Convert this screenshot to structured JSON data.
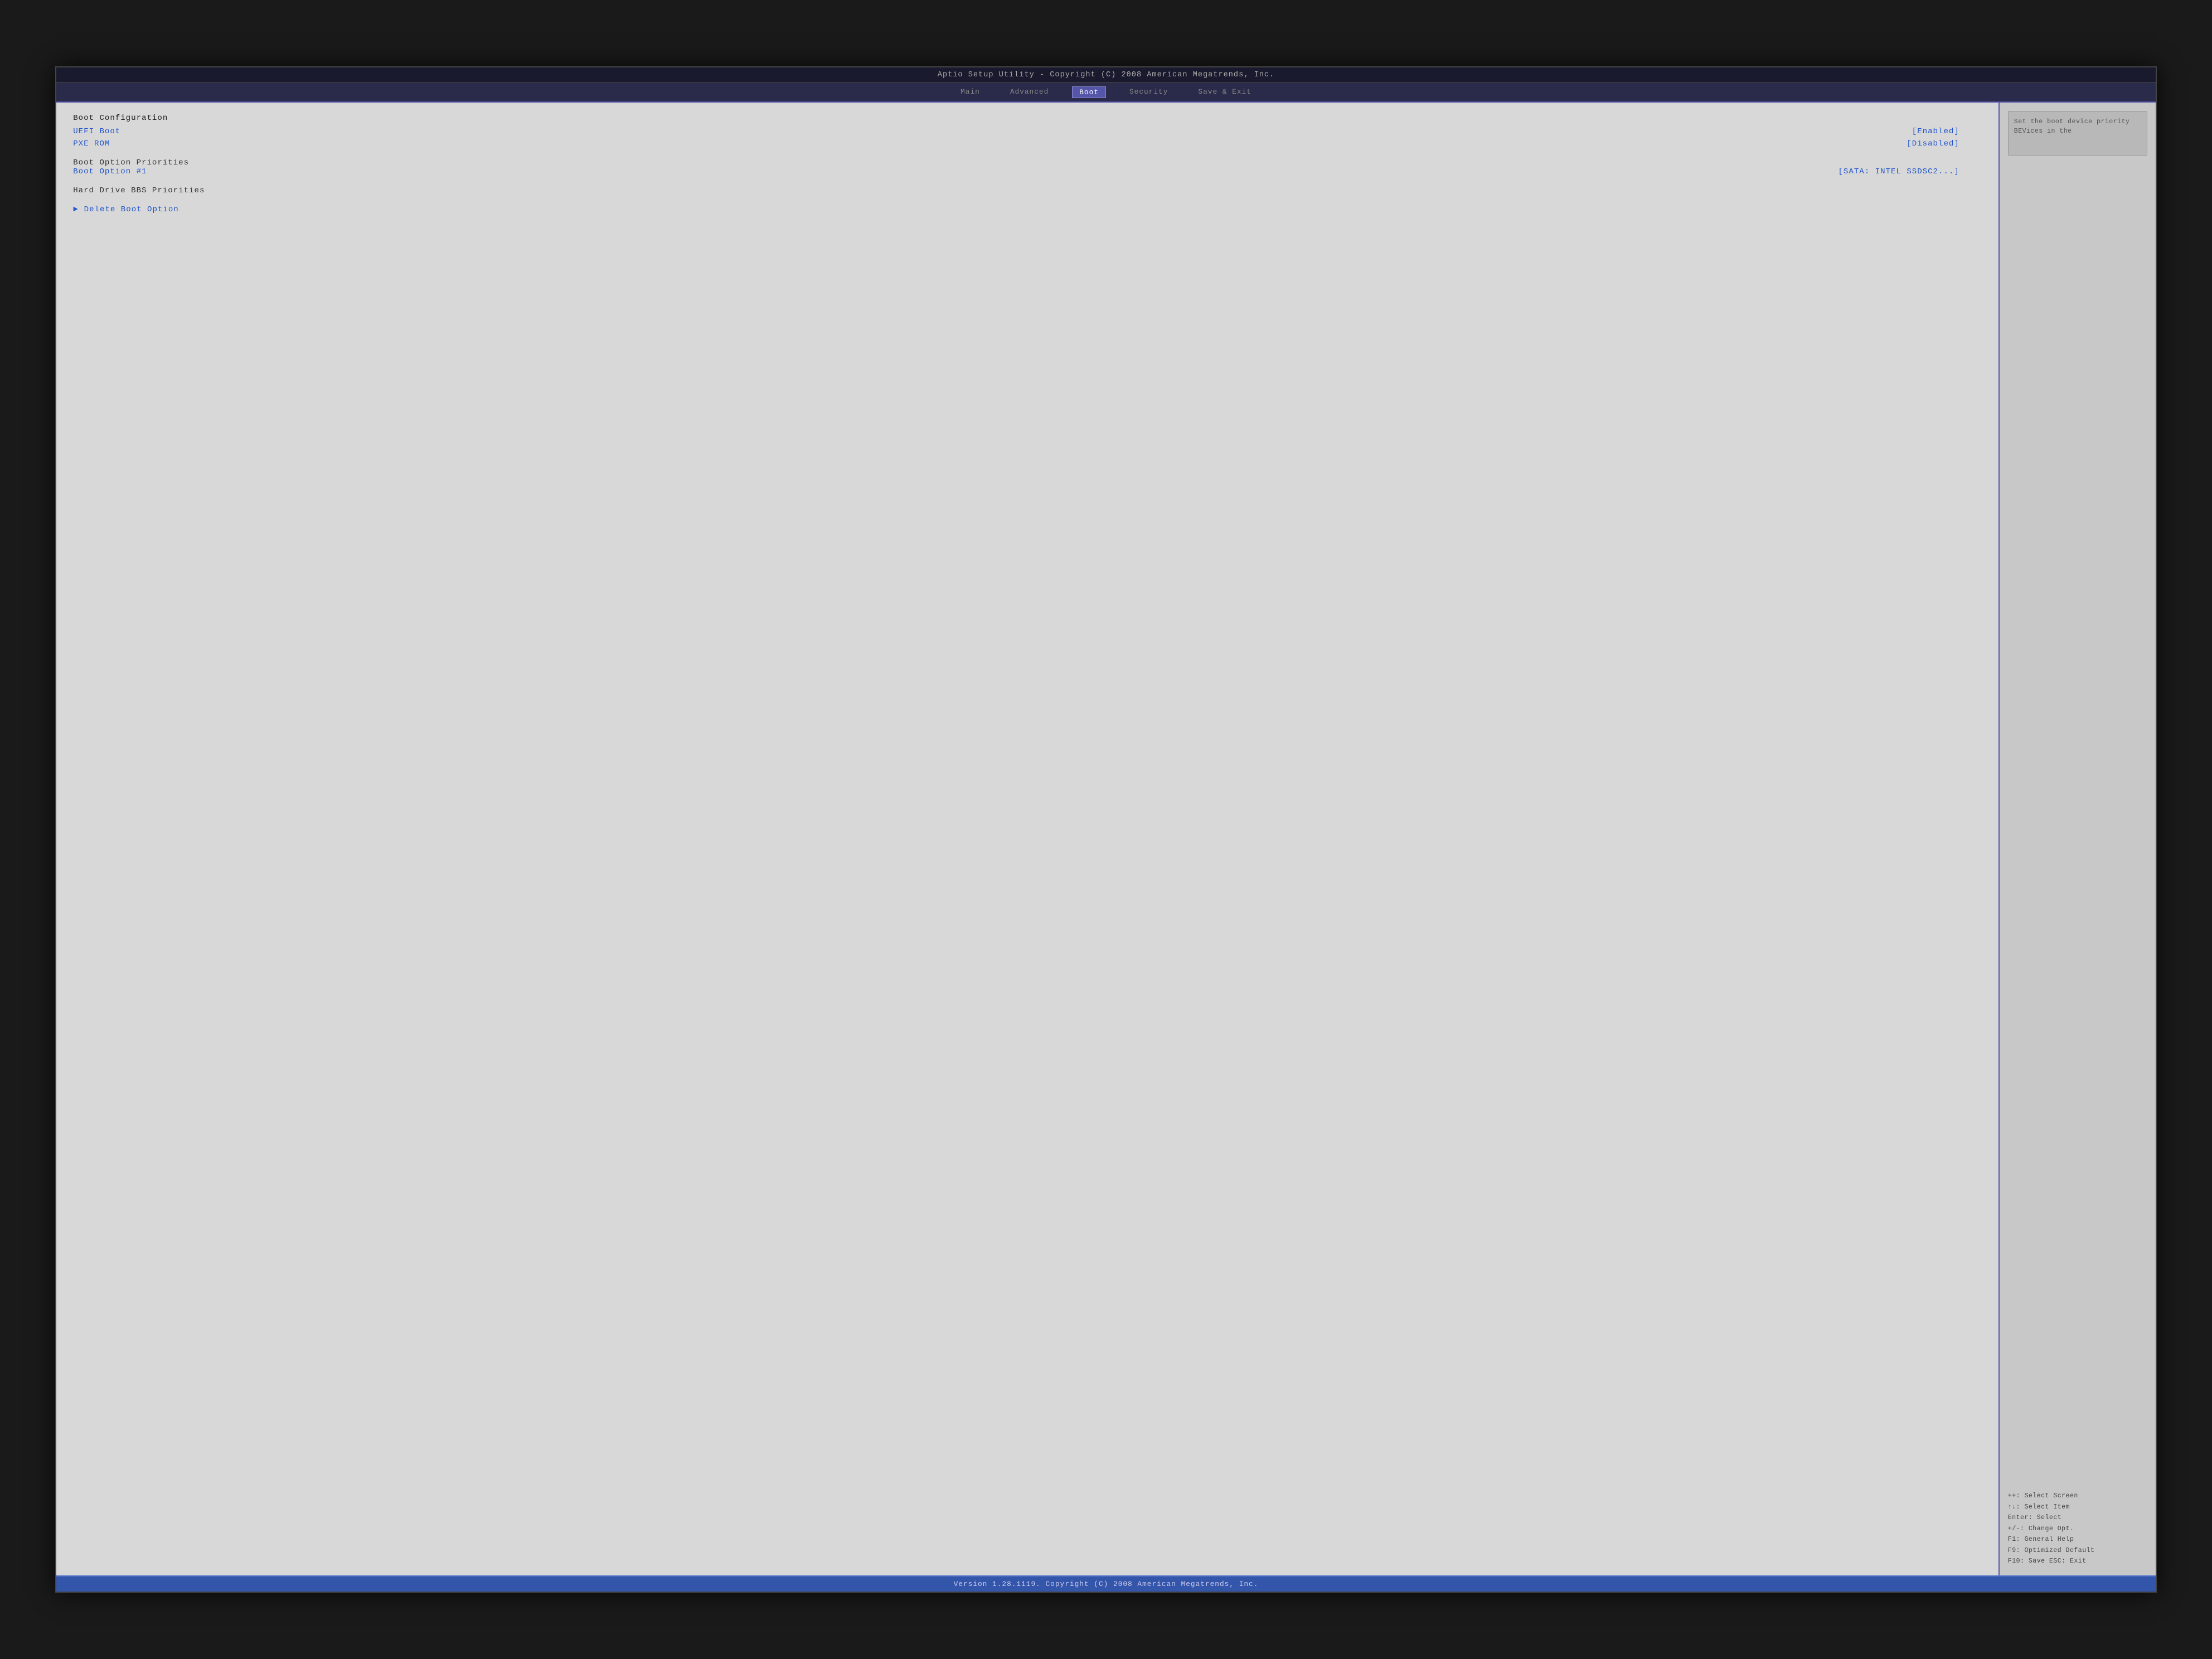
{
  "title_bar": {
    "text": "Aptio Setup Utility - Copyright (C) 2008 American Megatrends, Inc."
  },
  "menu_tabs": [
    {
      "id": "main",
      "label": "Main",
      "active": false
    },
    {
      "id": "advanced",
      "label": "Advanced",
      "active": false
    },
    {
      "id": "boot",
      "label": "Boot",
      "active": true
    },
    {
      "id": "security",
      "label": "Security",
      "active": false
    },
    {
      "id": "save_exit",
      "label": "Save & Exit",
      "active": false
    }
  ],
  "left_panel": {
    "sections": [
      {
        "id": "boot_configuration",
        "label": "Boot Configuration",
        "items": [
          {
            "id": "uefi_boot",
            "label": "UEFI Boot",
            "value": "[Enabled]",
            "type": "setting"
          },
          {
            "id": "pxe_rom",
            "label": "PXE ROM",
            "value": "[Disabled]",
            "type": "setting"
          }
        ]
      },
      {
        "id": "boot_option_priorities",
        "label": "Boot Option Priorities",
        "items": [
          {
            "id": "boot_option_1",
            "label": "Boot Option #1",
            "value": "[SATA: INTEL SSDSC2...]",
            "type": "setting"
          }
        ]
      },
      {
        "id": "hard_drive_bbs",
        "label": "Hard Drive BBS Priorities",
        "type": "submenu"
      },
      {
        "id": "delete_boot_option",
        "label": "Delete Boot Option",
        "type": "submenu_arrow"
      }
    ]
  },
  "right_panel": {
    "help_text": "Set the boot device priority",
    "help_text2": "BEVices in the",
    "keybinds": [
      {
        "key": "++:",
        "action": "Select Screen"
      },
      {
        "key": "↑↓:",
        "action": "Select Item"
      },
      {
        "key": "Enter:",
        "action": "Select"
      },
      {
        "key": "+/-:",
        "action": "Change Opt."
      },
      {
        "key": "F1:",
        "action": "General Help"
      },
      {
        "key": "F9:",
        "action": "Optimized Default"
      },
      {
        "key": "F10:",
        "action": "Save  ESC: Exit"
      }
    ]
  },
  "bottom_bar": {
    "text": "Version 1.28.1119. Copyright (C) 2008 American Megatrends, Inc."
  }
}
